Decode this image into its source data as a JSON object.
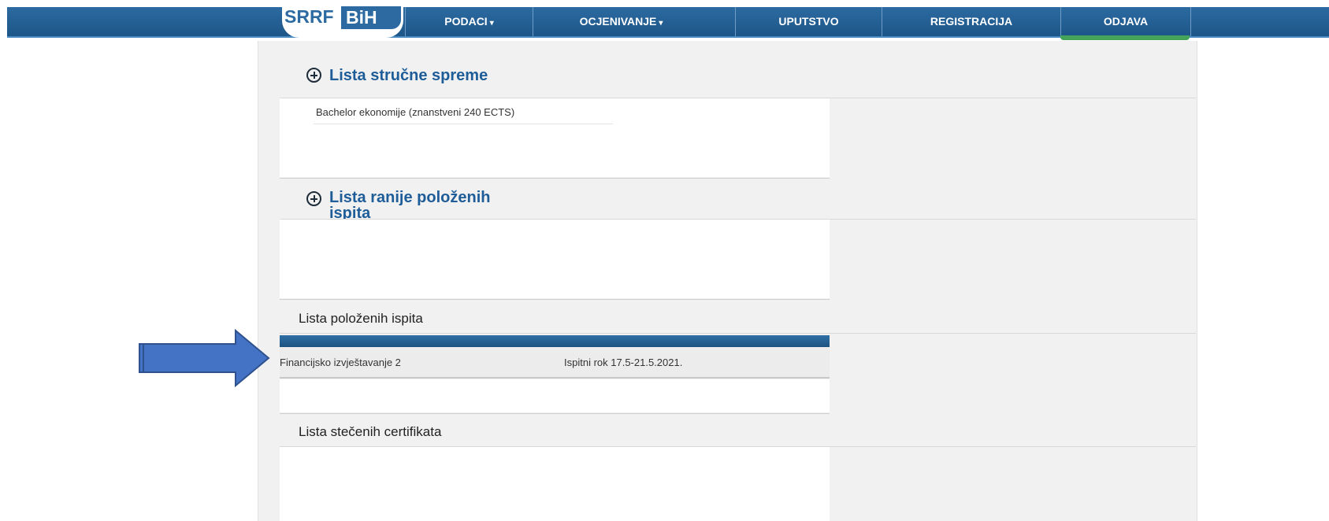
{
  "logo": {
    "part1": "SRRF",
    "part2": "BiH"
  },
  "nav": [
    {
      "label": "PODACI",
      "dropdown": true
    },
    {
      "label": "OCJENIVANJE",
      "dropdown": true
    },
    {
      "label": "UPUTSTVO",
      "dropdown": false
    },
    {
      "label": "REGISTRACIJA",
      "dropdown": false
    },
    {
      "label": "ODJAVA",
      "dropdown": false,
      "active": true
    }
  ],
  "sections": {
    "qualifications": {
      "title": "Lista stručne spreme",
      "items": [
        "Bachelor ekonomije (znanstveni 240 ECTS)"
      ]
    },
    "previous_exams": {
      "title_line1": "Lista ranije položenih",
      "title_line2": "ispita"
    },
    "passed_exams": {
      "title": "Lista položenih ispita",
      "rows": [
        {
          "subject": "Financijsko izvještavanje 2",
          "term": "Ispitni rok 17.5-21.5.2021."
        }
      ]
    },
    "certificates": {
      "title": "Lista stečenih certifikata"
    }
  },
  "colors": {
    "nav_bg": "#1d5688",
    "accent_green": "#44a55a",
    "arrow": "#4472c4",
    "title_blue": "#1f5d99"
  },
  "icons": {
    "expand": "plus-circle-icon",
    "pointer": "right-arrow-icon"
  }
}
